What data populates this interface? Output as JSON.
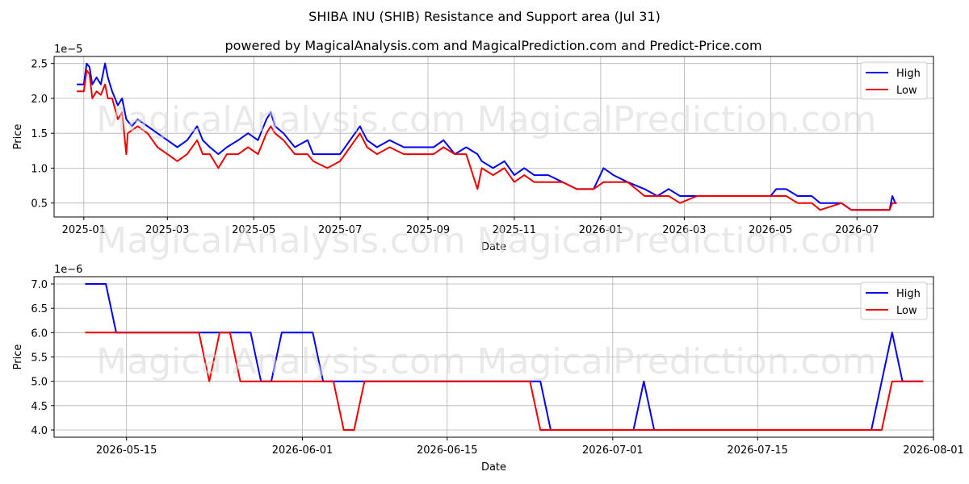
{
  "title": "SHIBA INU (SHIB) Resistance and Support area (Jul 31)",
  "subtitle": "powered by MagicalAnalysis.com and MagicalPrediction.com and Predict-Price.com",
  "watermarks": [
    "MagicalAnalysis.com",
    "MagicalPrediction.com"
  ],
  "colors": {
    "high": "#0000ee",
    "low": "#ee0000"
  },
  "chart_data": [
    {
      "type": "line",
      "xlabel": "Date",
      "ylabel": "Price",
      "offset_label": "1e−5",
      "ylim": [
        0.3,
        2.6
      ],
      "xlim": [
        "2024-12-11",
        "2026-08-24"
      ],
      "yticks": [
        0.5,
        1.0,
        1.5,
        2.0,
        2.5
      ],
      "ytick_labels": [
        "0.5",
        "1.0",
        "1.5",
        "2.0",
        "2.5"
      ],
      "xticks": [
        "2025-01-01",
        "2025-03-01",
        "2025-05-01",
        "2025-07-01",
        "2025-09-01",
        "2025-11-01",
        "2026-01-01",
        "2026-03-01",
        "2026-05-01",
        "2026-07-01"
      ],
      "xtick_labels": [
        "2025-01",
        "2025-03",
        "2025-05",
        "2025-07",
        "2025-09",
        "2025-11",
        "2026-01",
        "2026-03",
        "2026-05",
        "2026-07"
      ],
      "grid": true,
      "legend": "top-right",
      "series": [
        {
          "name": "High",
          "color": "#0000ee",
          "points": [
            [
              "2024-12-27",
              2.2
            ],
            [
              "2025-01-01",
              2.2
            ],
            [
              "2025-01-03",
              2.5
            ],
            [
              "2025-01-05",
              2.45
            ],
            [
              "2025-01-07",
              2.2
            ],
            [
              "2025-01-10",
              2.3
            ],
            [
              "2025-01-13",
              2.2
            ],
            [
              "2025-01-16",
              2.5
            ],
            [
              "2025-01-18",
              2.3
            ],
            [
              "2025-01-21",
              2.1
            ],
            [
              "2025-01-25",
              1.9
            ],
            [
              "2025-01-28",
              2.0
            ],
            [
              "2025-01-31",
              1.7
            ],
            [
              "2025-02-04",
              1.6
            ],
            [
              "2025-02-08",
              1.7
            ],
            [
              "2025-02-15",
              1.6
            ],
            [
              "2025-02-22",
              1.5
            ],
            [
              "2025-03-01",
              1.4
            ],
            [
              "2025-03-08",
              1.3
            ],
            [
              "2025-03-15",
              1.4
            ],
            [
              "2025-03-22",
              1.6
            ],
            [
              "2025-03-26",
              1.4
            ],
            [
              "2025-03-31",
              1.3
            ],
            [
              "2025-04-06",
              1.2
            ],
            [
              "2025-04-12",
              1.3
            ],
            [
              "2025-04-20",
              1.4
            ],
            [
              "2025-04-27",
              1.5
            ],
            [
              "2025-05-04",
              1.4
            ],
            [
              "2025-05-10",
              1.7
            ],
            [
              "2025-05-13",
              1.8
            ],
            [
              "2025-05-16",
              1.6
            ],
            [
              "2025-05-22",
              1.5
            ],
            [
              "2025-05-30",
              1.3
            ],
            [
              "2025-06-08",
              1.4
            ],
            [
              "2025-06-12",
              1.2
            ],
            [
              "2025-06-22",
              1.2
            ],
            [
              "2025-07-01",
              1.2
            ],
            [
              "2025-07-08",
              1.4
            ],
            [
              "2025-07-15",
              1.6
            ],
            [
              "2025-07-20",
              1.4
            ],
            [
              "2025-07-27",
              1.3
            ],
            [
              "2025-08-05",
              1.4
            ],
            [
              "2025-08-15",
              1.3
            ],
            [
              "2025-08-29",
              1.3
            ],
            [
              "2025-09-05",
              1.3
            ],
            [
              "2025-09-12",
              1.4
            ],
            [
              "2025-09-20",
              1.2
            ],
            [
              "2025-09-28",
              1.3
            ],
            [
              "2025-10-06",
              1.2
            ],
            [
              "2025-10-09",
              1.1
            ],
            [
              "2025-10-17",
              1.0
            ],
            [
              "2025-10-25",
              1.1
            ],
            [
              "2025-11-01",
              0.9
            ],
            [
              "2025-11-08",
              1.0
            ],
            [
              "2025-11-15",
              0.9
            ],
            [
              "2025-11-25",
              0.9
            ],
            [
              "2025-12-05",
              0.8
            ],
            [
              "2025-12-15",
              0.7
            ],
            [
              "2025-12-27",
              0.7
            ],
            [
              "2026-01-03",
              1.0
            ],
            [
              "2026-01-10",
              0.9
            ],
            [
              "2026-01-20",
              0.8
            ],
            [
              "2026-02-01",
              0.7
            ],
            [
              "2026-02-10",
              0.6
            ],
            [
              "2026-02-18",
              0.7
            ],
            [
              "2026-02-26",
              0.6
            ],
            [
              "2026-03-10",
              0.6
            ],
            [
              "2026-03-25",
              0.6
            ],
            [
              "2026-04-15",
              0.6
            ],
            [
              "2026-05-01",
              0.6
            ],
            [
              "2026-05-05",
              0.7
            ],
            [
              "2026-05-12",
              0.7
            ],
            [
              "2026-05-20",
              0.6
            ],
            [
              "2026-05-30",
              0.6
            ],
            [
              "2026-06-05",
              0.5
            ],
            [
              "2026-06-20",
              0.5
            ],
            [
              "2026-06-27",
              0.4
            ],
            [
              "2026-07-10",
              0.4
            ],
            [
              "2026-07-24",
              0.4
            ],
            [
              "2026-07-26",
              0.6
            ],
            [
              "2026-07-28",
              0.5
            ],
            [
              "2026-07-29",
              0.5
            ]
          ]
        },
        {
          "name": "Low",
          "color": "#ee0000",
          "points": [
            [
              "2024-12-27",
              2.1
            ],
            [
              "2025-01-01",
              2.1
            ],
            [
              "2025-01-03",
              2.4
            ],
            [
              "2025-01-05",
              2.35
            ],
            [
              "2025-01-07",
              2.0
            ],
            [
              "2025-01-10",
              2.1
            ],
            [
              "2025-01-13",
              2.05
            ],
            [
              "2025-01-16",
              2.2
            ],
            [
              "2025-01-18",
              2.0
            ],
            [
              "2025-01-21",
              2.0
            ],
            [
              "2025-01-25",
              1.7
            ],
            [
              "2025-01-28",
              1.8
            ],
            [
              "2025-01-31",
              1.2
            ],
            [
              "2025-02-01",
              1.5
            ],
            [
              "2025-02-08",
              1.6
            ],
            [
              "2025-02-15",
              1.5
            ],
            [
              "2025-02-22",
              1.3
            ],
            [
              "2025-03-01",
              1.2
            ],
            [
              "2025-03-08",
              1.1
            ],
            [
              "2025-03-15",
              1.2
            ],
            [
              "2025-03-22",
              1.4
            ],
            [
              "2025-03-26",
              1.2
            ],
            [
              "2025-03-31",
              1.2
            ],
            [
              "2025-04-06",
              1.0
            ],
            [
              "2025-04-12",
              1.2
            ],
            [
              "2025-04-20",
              1.2
            ],
            [
              "2025-04-27",
              1.3
            ],
            [
              "2025-05-04",
              1.2
            ],
            [
              "2025-05-10",
              1.5
            ],
            [
              "2025-05-13",
              1.6
            ],
            [
              "2025-05-16",
              1.5
            ],
            [
              "2025-05-22",
              1.4
            ],
            [
              "2025-05-30",
              1.2
            ],
            [
              "2025-06-08",
              1.2
            ],
            [
              "2025-06-12",
              1.1
            ],
            [
              "2025-06-22",
              1.0
            ],
            [
              "2025-07-01",
              1.1
            ],
            [
              "2025-07-08",
              1.3
            ],
            [
              "2025-07-15",
              1.5
            ],
            [
              "2025-07-20",
              1.3
            ],
            [
              "2025-07-27",
              1.2
            ],
            [
              "2025-08-05",
              1.3
            ],
            [
              "2025-08-15",
              1.2
            ],
            [
              "2025-08-29",
              1.2
            ],
            [
              "2025-09-05",
              1.2
            ],
            [
              "2025-09-12",
              1.3
            ],
            [
              "2025-09-20",
              1.2
            ],
            [
              "2025-09-28",
              1.2
            ],
            [
              "2025-10-06",
              0.7
            ],
            [
              "2025-10-09",
              1.0
            ],
            [
              "2025-10-17",
              0.9
            ],
            [
              "2025-10-25",
              1.0
            ],
            [
              "2025-11-01",
              0.8
            ],
            [
              "2025-11-08",
              0.9
            ],
            [
              "2025-11-15",
              0.8
            ],
            [
              "2025-11-25",
              0.8
            ],
            [
              "2025-12-05",
              0.8
            ],
            [
              "2025-12-15",
              0.7
            ],
            [
              "2025-12-27",
              0.7
            ],
            [
              "2026-01-03",
              0.8
            ],
            [
              "2026-01-10",
              0.8
            ],
            [
              "2026-01-20",
              0.8
            ],
            [
              "2026-02-01",
              0.6
            ],
            [
              "2026-02-10",
              0.6
            ],
            [
              "2026-02-18",
              0.6
            ],
            [
              "2026-02-26",
              0.5
            ],
            [
              "2026-03-10",
              0.6
            ],
            [
              "2026-03-25",
              0.6
            ],
            [
              "2026-04-15",
              0.6
            ],
            [
              "2026-05-01",
              0.6
            ],
            [
              "2026-05-05",
              0.6
            ],
            [
              "2026-05-12",
              0.6
            ],
            [
              "2026-05-20",
              0.5
            ],
            [
              "2026-05-30",
              0.5
            ],
            [
              "2026-06-05",
              0.4
            ],
            [
              "2026-06-20",
              0.5
            ],
            [
              "2026-06-27",
              0.4
            ],
            [
              "2026-07-10",
              0.4
            ],
            [
              "2026-07-24",
              0.4
            ],
            [
              "2026-07-26",
              0.5
            ],
            [
              "2026-07-28",
              0.5
            ],
            [
              "2026-07-29",
              0.5
            ]
          ]
        }
      ]
    },
    {
      "type": "line",
      "xlabel": "Date",
      "ylabel": "Price",
      "offset_label": "1e−6",
      "ylim": [
        3.85,
        7.15
      ],
      "xlim": [
        "2026-05-08",
        "2026-08-01"
      ],
      "yticks": [
        4.0,
        4.5,
        5.0,
        5.5,
        6.0,
        6.5,
        7.0
      ],
      "ytick_labels": [
        "4.0",
        "4.5",
        "5.0",
        "5.5",
        "6.0",
        "6.5",
        "7.0"
      ],
      "xticks": [
        "2026-05-15",
        "2026-06-01",
        "2026-06-15",
        "2026-07-01",
        "2026-07-15",
        "2026-08-01"
      ],
      "xtick_labels": [
        "2026-05-15",
        "2026-06-01",
        "2026-06-15",
        "2026-07-01",
        "2026-07-15",
        "2026-08-01"
      ],
      "grid": true,
      "legend": "top-right",
      "series": [
        {
          "name": "High",
          "color": "#0000ee",
          "points": [
            [
              "2026-05-11",
              7.0
            ],
            [
              "2026-05-13",
              7.0
            ],
            [
              "2026-05-14",
              6.0
            ],
            [
              "2026-05-21",
              6.0
            ],
            [
              "2026-05-22",
              6.0
            ],
            [
              "2026-05-25",
              6.0
            ],
            [
              "2026-05-26",
              6.0
            ],
            [
              "2026-05-27",
              6.0
            ],
            [
              "2026-05-28",
              5.0
            ],
            [
              "2026-05-29",
              5.0
            ],
            [
              "2026-05-30",
              6.0
            ],
            [
              "2026-06-02",
              6.0
            ],
            [
              "2026-06-03",
              5.0
            ],
            [
              "2026-06-04",
              5.0
            ],
            [
              "2026-06-05",
              5.0
            ],
            [
              "2026-06-06",
              5.0
            ],
            [
              "2026-06-07",
              5.0
            ],
            [
              "2026-06-23",
              5.0
            ],
            [
              "2026-06-24",
              5.0
            ],
            [
              "2026-06-25",
              4.0
            ],
            [
              "2026-07-03",
              4.0
            ],
            [
              "2026-07-04",
              5.0
            ],
            [
              "2026-07-05",
              4.0
            ],
            [
              "2026-07-26",
              4.0
            ],
            [
              "2026-07-27",
              5.0
            ],
            [
              "2026-07-28",
              6.0
            ],
            [
              "2026-07-29",
              5.0
            ],
            [
              "2026-07-31",
              5.0
            ]
          ]
        },
        {
          "name": "Low",
          "color": "#ee0000",
          "points": [
            [
              "2026-05-11",
              6.0
            ],
            [
              "2026-05-13",
              6.0
            ],
            [
              "2026-05-14",
              6.0
            ],
            [
              "2026-05-21",
              6.0
            ],
            [
              "2026-05-22",
              6.0
            ],
            [
              "2026-05-23",
              5.0
            ],
            [
              "2026-05-24",
              6.0
            ],
            [
              "2026-05-25",
              6.0
            ],
            [
              "2026-05-26",
              5.0
            ],
            [
              "2026-05-27",
              5.0
            ],
            [
              "2026-05-28",
              5.0
            ],
            [
              "2026-05-29",
              5.0
            ],
            [
              "2026-05-30",
              5.0
            ],
            [
              "2026-06-02",
              5.0
            ],
            [
              "2026-06-03",
              5.0
            ],
            [
              "2026-06-04",
              5.0
            ],
            [
              "2026-06-05",
              4.0
            ],
            [
              "2026-06-06",
              4.0
            ],
            [
              "2026-06-07",
              5.0
            ],
            [
              "2026-06-23",
              5.0
            ],
            [
              "2026-06-24",
              4.0
            ],
            [
              "2026-06-25",
              4.0
            ],
            [
              "2026-07-03",
              4.0
            ],
            [
              "2026-07-04",
              4.0
            ],
            [
              "2026-07-05",
              4.0
            ],
            [
              "2026-07-26",
              4.0
            ],
            [
              "2026-07-27",
              4.0
            ],
            [
              "2026-07-28",
              5.0
            ],
            [
              "2026-07-29",
              5.0
            ],
            [
              "2026-07-31",
              5.0
            ]
          ]
        }
      ]
    }
  ]
}
